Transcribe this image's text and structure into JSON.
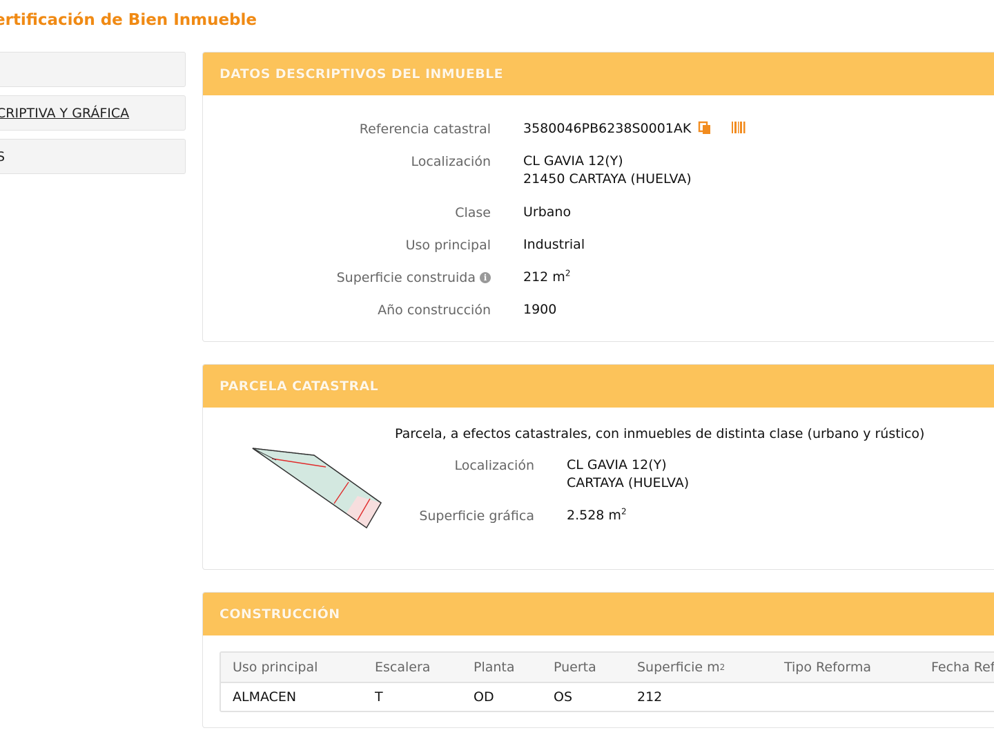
{
  "page": {
    "title": "ertificación de Bien Inmueble"
  },
  "sidebar": {
    "items": [
      {
        "label": ""
      },
      {
        "label": "CRIPTIVA Y GRÁFICA"
      },
      {
        "label": "S"
      }
    ]
  },
  "datos": {
    "header": "DATOS DESCRIPTIVOS DEL INMUEBLE",
    "referencia_label": "Referencia catastral",
    "referencia_value": "3580046PB6238S0001AK",
    "localizacion_label": "Localización",
    "localizacion_line1": "CL GAVIA 12(Y)",
    "localizacion_line2": "21450 CARTAYA (HUELVA)",
    "clase_label": "Clase",
    "clase_value": "Urbano",
    "uso_label": "Uso principal",
    "uso_value": "Industrial",
    "superficie_label": "Superficie construida",
    "superficie_value": "212 m",
    "superficie_exp": "2",
    "anio_label": "Año construcción",
    "anio_value": "1900"
  },
  "parcela": {
    "header": "PARCELA CATASTRAL",
    "description": "Parcela, a efectos catastrales, con inmuebles de distinta clase (urbano y rústico)",
    "localizacion_label": "Localización",
    "localizacion_line1": "CL GAVIA 12(Y)",
    "localizacion_line2": "CARTAYA (HUELVA)",
    "superficie_label": "Superficie gráfica",
    "superficie_value": "2.528 m",
    "superficie_exp": "2"
  },
  "construccion": {
    "header": "CONSTRUCCIÓN",
    "columns": [
      "Uso principal",
      "Escalera",
      "Planta",
      "Puerta",
      "Superficie m",
      "Tipo Reforma",
      "Fecha Ref"
    ],
    "superficie_exp": "2",
    "rows": [
      [
        "ALMACEN",
        "T",
        "OD",
        "OS",
        "212",
        "",
        ""
      ]
    ]
  },
  "colors": {
    "accent": "#f08a14",
    "header_bg": "#fcc35a",
    "icon_orange": "#f28c1f"
  },
  "icons": [
    "copy-icon",
    "barcode-icon",
    "info-icon",
    "parcel-map"
  ]
}
